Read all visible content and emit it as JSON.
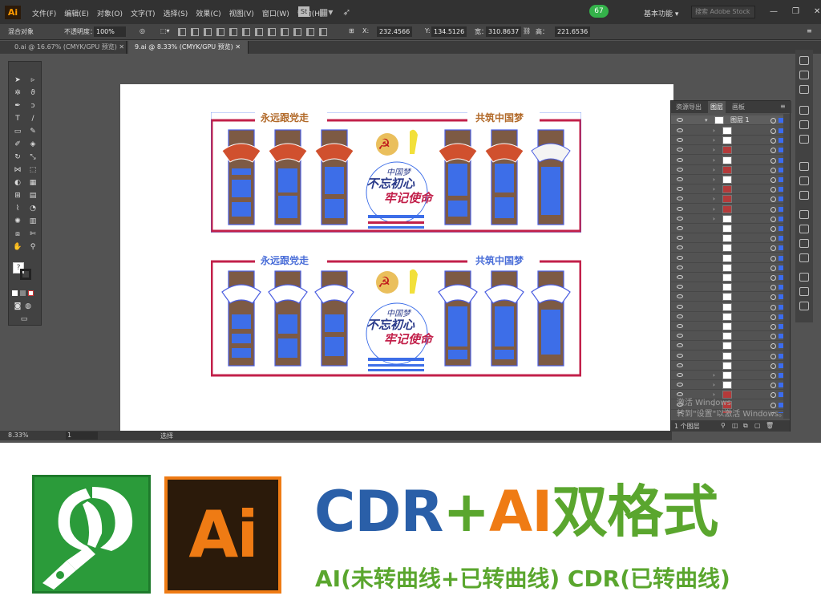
{
  "app": {
    "logo": "Ai",
    "menus": [
      "文件(F)",
      "编辑(E)",
      "对象(O)",
      "文字(T)",
      "选择(S)",
      "效果(C)",
      "视图(V)",
      "窗口(W)",
      "帮助(H)"
    ],
    "st_label": "St",
    "badge": "67",
    "workspace": "基本功能",
    "stock_search_placeholder": "搜索 Adobe Stock"
  },
  "control_bar": {
    "selection": "混合对象",
    "opacity_label": "不透明度：",
    "opacity_value": "100%",
    "x_label": "X:",
    "x_value": "232.4566",
    "y_label": "Y:",
    "y_value": "134.5126",
    "w_label": "宽：",
    "w_value": "310.8637",
    "h_label": "高：",
    "h_value": "221.6536"
  },
  "tabs": [
    {
      "label": "0.ai @ 16.67% (CMYK/GPU 预览)"
    },
    {
      "label": "9.ai @ 8.33% (CMYK/GPU 预览)"
    }
  ],
  "status": {
    "zoom": "8.33%",
    "page": "1",
    "mode": "选择"
  },
  "layers_panel": {
    "tabs": [
      "资源导出",
      "图层",
      "画板"
    ],
    "root_layer": "图层 1",
    "footer": "1 个图层"
  },
  "activate_windows": {
    "line1": "激活 Windows",
    "line2": "转到\"设置\"以激活 Windows。"
  },
  "artwork": {
    "left_heading": "永远跟党走",
    "right_heading": "共筑中国梦",
    "slogan_top": "中国梦",
    "slogan_line1": "不忘初心",
    "slogan_line2": "牢记使命"
  },
  "banner": {
    "headline_cdr": "CDR",
    "headline_plus": "+",
    "headline_ai": "AI",
    "headline_suffix": "双格式",
    "subline": "AI(未转曲线+已转曲线) CDR(已转曲线)",
    "ai_logo_text": "Ai",
    "colors": {
      "cdr_blue": "#2a5fa8",
      "ai_orange": "#ef7b14",
      "green": "#5aa62e"
    }
  }
}
